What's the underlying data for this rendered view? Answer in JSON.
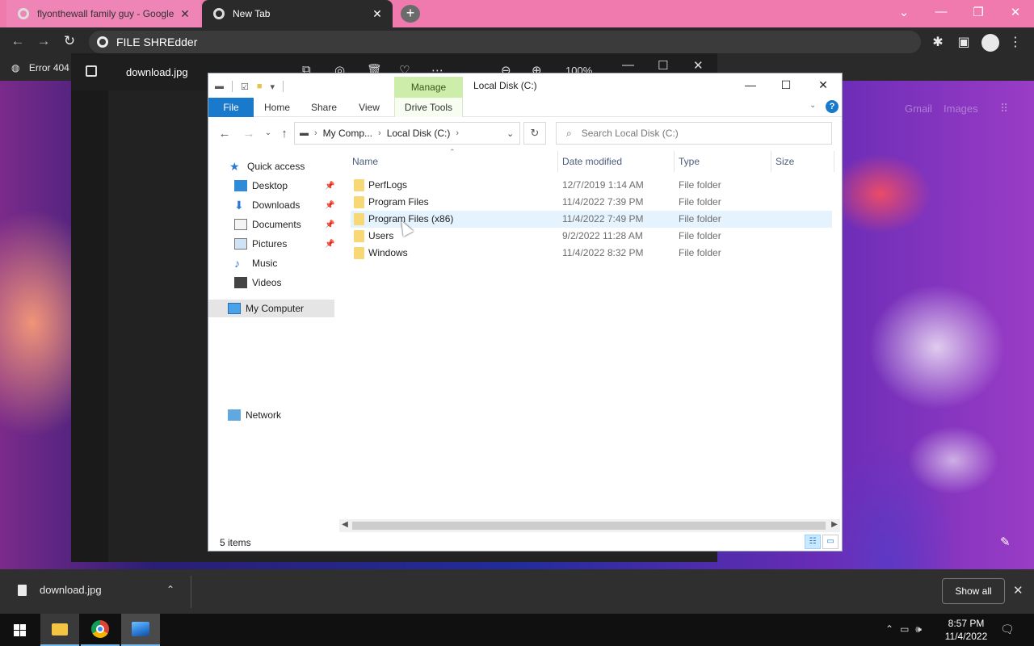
{
  "browser": {
    "tabs": [
      {
        "title": "flyonthewall family guy - Google",
        "favicon": "google-g-icon",
        "active": false
      },
      {
        "title": "New Tab",
        "favicon": "chrome-icon",
        "active": true
      }
    ],
    "omnibox_text": "FILE SHREdder",
    "bookmark": "Error 404",
    "accent": "#f07aae"
  },
  "newtab_page": {
    "gmail_link": "Gmail",
    "images_link": "Images"
  },
  "photo_viewer": {
    "title": "download.jpg",
    "zoom": "100%"
  },
  "explorer": {
    "manage_tab": "Manage",
    "title": "Local Disk (C:)",
    "ribbon_tabs": [
      "File",
      "Home",
      "Share",
      "View",
      "Drive Tools"
    ],
    "breadcrumb": [
      "My Comp...",
      "Local Disk (C:)"
    ],
    "search_placeholder": "Search Local Disk (C:)",
    "nav": {
      "quick_access": "Quick access",
      "items": [
        "Desktop",
        "Downloads",
        "Documents",
        "Pictures",
        "Music",
        "Videos"
      ],
      "my_computer": "My Computer",
      "network": "Network"
    },
    "columns": [
      "Name",
      "Date modified",
      "Type",
      "Size"
    ],
    "rows": [
      {
        "name": "PerfLogs",
        "date": "12/7/2019 1:14 AM",
        "type": "File folder"
      },
      {
        "name": "Program Files",
        "date": "11/4/2022 7:39 PM",
        "type": "File folder"
      },
      {
        "name": "Program Files (x86)",
        "date": "11/4/2022 7:49 PM",
        "type": "File folder"
      },
      {
        "name": "Users",
        "date": "9/2/2022 11:28 AM",
        "type": "File folder"
      },
      {
        "name": "Windows",
        "date": "11/4/2022 8:32 PM",
        "type": "File folder"
      }
    ],
    "status": "5 items",
    "accent": "#1979ca"
  },
  "downloads": {
    "file": "download.jpg",
    "show_all": "Show all"
  },
  "taskbar": {
    "time": "8:57 PM",
    "date": "11/4/2022"
  }
}
